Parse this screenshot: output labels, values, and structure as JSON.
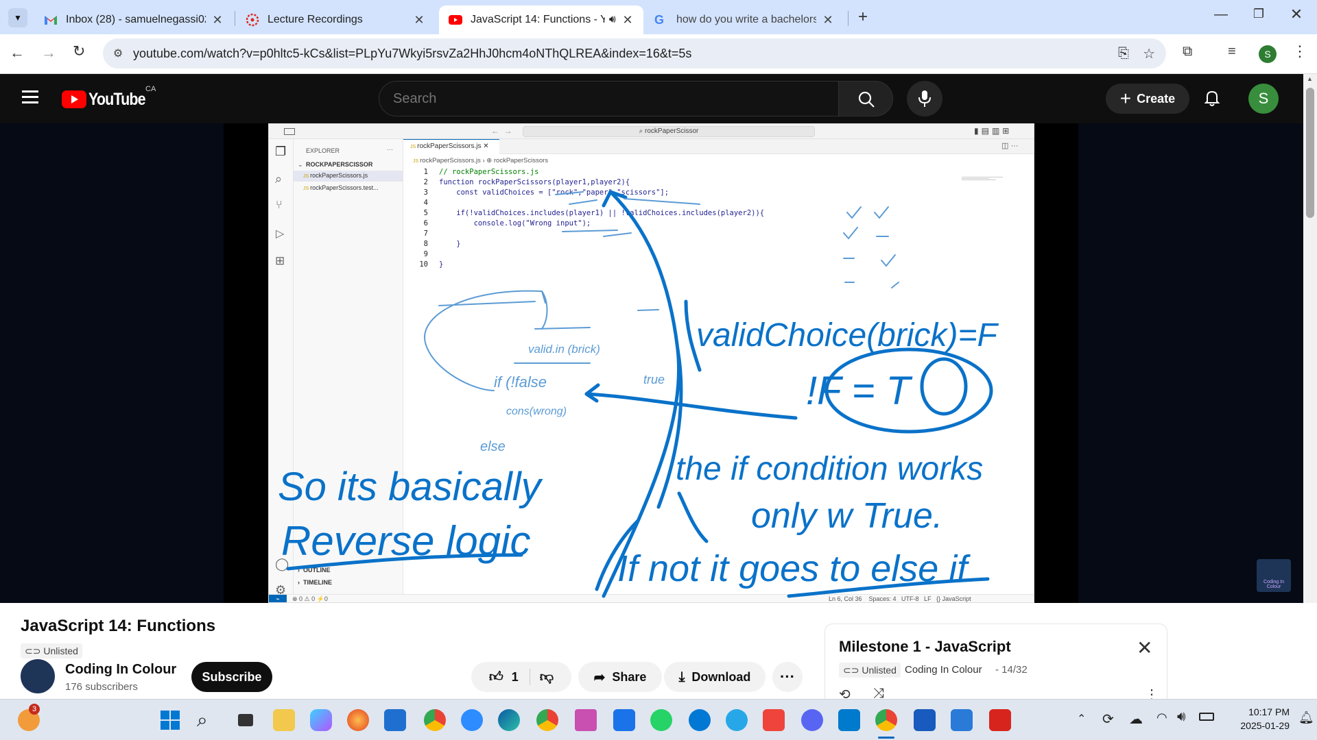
{
  "browser": {
    "tabs": [
      {
        "title": "Inbox (28) - samuelnegassi02@",
        "favicon": "gmail-icon"
      },
      {
        "title": "Lecture Recordings",
        "favicon": "canvas-icon"
      },
      {
        "title": "JavaScript 14: Functions - Yo",
        "favicon": "youtube-icon"
      },
      {
        "title": "how do you write a bachelors d",
        "favicon": "google-icon"
      }
    ],
    "url": "youtube.com/watch?v=p0hltc5-kCs&list=PLpYu7Wkyi5rsvZa2HhJ0hcm4oNThQLREA&index=16&t=5s",
    "profile_initial": "S"
  },
  "youtube": {
    "logo_text": "YouTube",
    "region": "CA",
    "search_placeholder": "Search",
    "create_label": "Create",
    "avatar_initial": "S"
  },
  "vscode": {
    "search_text": "rockPaperScissor",
    "explorer_title": "EXPLORER",
    "folder": "ROCKPAPERSCISSOR",
    "files": [
      "rockPaperScissors.js",
      "rockPaperScissors.test..."
    ],
    "tab": "rockPaperScissors.js",
    "breadcrumb_file": "rockPaperScissors.js",
    "breadcrumb_symbol": "rockPaperScissors",
    "code_lines": [
      "// rockPaperScissors.js",
      "function rockPaperScissors(player1,player2){",
      "    const validChoices = [\"rock\",\"paper\",\"scissors\"];",
      "",
      "    if(!validChoices.includes(player1) || !validChoices.includes(player2)){",
      "        console.log(\"Wrong input\");",
      "",
      "    }",
      "",
      "}"
    ],
    "outline_label": "OUTLINE",
    "timeline_label": "TIMELINE",
    "status_left": "⊗ 0 ⚠ 0   ⚡0",
    "status_right": "Ln 6, Col 36    Spaces: 4   UTF-8   LF   {} JavaScript"
  },
  "handwriting": {
    "note1": "validChoice(brick)=F",
    "note2": "!F = T",
    "note3": "So its basically",
    "note4": "Reverse logic",
    "note5": "the if condition works",
    "note6": "only w True.",
    "note7": "If not it goes to else if",
    "small1": "if (!false",
    "small2": "cons(wrong)",
    "small3": "true",
    "small4": "else",
    "small5": "valid.in (brick)"
  },
  "video": {
    "title": "JavaScript 14: Functions",
    "visibility": "Unlisted",
    "channel": "Coding In Colour",
    "subscribers": "176 subscribers",
    "subscribe_label": "Subscribe",
    "likes": "1",
    "share_label": "Share",
    "download_label": "Download",
    "channel_watermark": "Coding In Colour"
  },
  "playlist": {
    "title": "Milestone 1 - JavaScript",
    "visibility": "Unlisted",
    "channel": "Coding In Colour",
    "position": "- 14/32"
  },
  "taskbar": {
    "time": "10:17 PM",
    "date": "2025-01-29",
    "badge": "3"
  }
}
